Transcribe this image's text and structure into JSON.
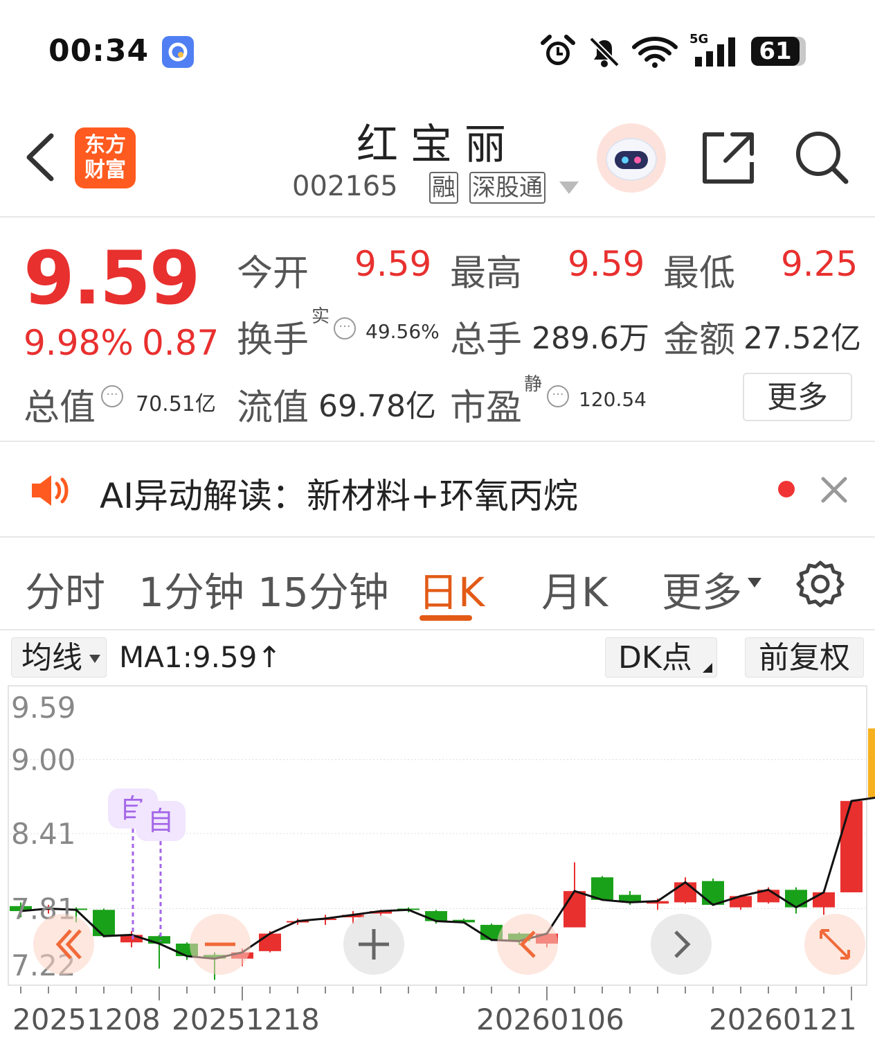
{
  "status_bar": {
    "time": "00:34",
    "network": "5G",
    "battery": "61",
    "icons": [
      "browser-app-icon",
      "alarm-icon",
      "mute-icon",
      "wifi-icon",
      "signal-icon",
      "battery-icon"
    ]
  },
  "header": {
    "stock_name": "红宝丽",
    "stock_code": "002165",
    "tags": [
      "融",
      "深股通"
    ],
    "logo_text": [
      "东方",
      "财富"
    ],
    "icons": [
      "back-icon",
      "assistant-robot-icon",
      "share-icon",
      "search-icon"
    ]
  },
  "quote": {
    "price": "9.59",
    "change_pct": "9.98%",
    "change_abs": "0.87",
    "open_label": "今开",
    "open_value": "9.59",
    "high_label": "最高",
    "high_value": "9.59",
    "low_label": "最低",
    "low_value": "9.25",
    "turnover_label": "换手",
    "turnover_sup": "实",
    "turnover_value": "49.56%",
    "volume_label": "总手",
    "volume_value": "289.6万",
    "amount_label": "金额",
    "amount_value": "27.52亿",
    "mktcap_label": "总值",
    "mktcap_value": "70.51亿",
    "float_label": "流值",
    "float_value": "69.78亿",
    "pe_label": "市盈",
    "pe_sup": "静",
    "pe_value": "120.54",
    "more_label": "更多"
  },
  "ai_bar": {
    "text": "AI异动解读：新材料+环氧丙烷"
  },
  "tabs": {
    "items": [
      "分时",
      "1分钟",
      "15分钟",
      "日K",
      "月K",
      "更多"
    ],
    "active": "日K"
  },
  "chart_toolbar": {
    "indicator": "均线",
    "ma_text": "MA1:9.59↑",
    "dk_label": "DK点",
    "adjust_label": "前复权"
  },
  "colors": {
    "up": "#e8302f",
    "down": "#1aa11a",
    "accent": "#e25a16",
    "today_candle": "#f7b11e",
    "marker": "#a466e8"
  },
  "chart_data": {
    "type": "candlestick",
    "y_ticks": [
      "9.59",
      "9.00",
      "8.41",
      "7.81",
      "7.22"
    ],
    "ylim": [
      7.22,
      9.59
    ],
    "x_tick_labels": [
      "20251208",
      "20251218",
      "20260106",
      "20260121"
    ],
    "markers": [
      "自",
      "自"
    ],
    "candles": [
      {
        "o": 7.83,
        "h": 7.86,
        "l": 7.74,
        "c": 7.79
      },
      {
        "o": 7.8,
        "h": 7.84,
        "l": 7.77,
        "c": 7.81
      },
      {
        "o": 7.81,
        "h": 7.82,
        "l": 7.7,
        "c": 7.8
      },
      {
        "o": 7.8,
        "h": 7.81,
        "l": 7.58,
        "c": 7.59
      },
      {
        "o": 7.54,
        "h": 7.63,
        "l": 7.5,
        "c": 7.6
      },
      {
        "o": 7.59,
        "h": 7.6,
        "l": 7.33,
        "c": 7.53
      },
      {
        "o": 7.53,
        "h": 7.54,
        "l": 7.4,
        "c": 7.43
      },
      {
        "o": 7.44,
        "h": 7.46,
        "l": 7.24,
        "c": 7.41
      },
      {
        "o": 7.41,
        "h": 7.49,
        "l": 7.35,
        "c": 7.46
      },
      {
        "o": 7.47,
        "h": 7.63,
        "l": 7.46,
        "c": 7.61
      },
      {
        "o": 7.7,
        "h": 7.73,
        "l": 7.68,
        "c": 7.71
      },
      {
        "o": 7.72,
        "h": 7.76,
        "l": 7.68,
        "c": 7.73
      },
      {
        "o": 7.74,
        "h": 7.79,
        "l": 7.69,
        "c": 7.76
      },
      {
        "o": 7.77,
        "h": 7.8,
        "l": 7.75,
        "c": 7.79
      },
      {
        "o": 7.81,
        "h": 7.82,
        "l": 7.78,
        "c": 7.8
      },
      {
        "o": 7.79,
        "h": 7.8,
        "l": 7.69,
        "c": 7.71
      },
      {
        "o": 7.72,
        "h": 7.73,
        "l": 7.69,
        "c": 7.7
      },
      {
        "o": 7.68,
        "h": 7.69,
        "l": 7.55,
        "c": 7.56
      },
      {
        "o": 7.61,
        "h": 7.62,
        "l": 7.52,
        "c": 7.55
      },
      {
        "o": 7.53,
        "h": 7.62,
        "l": 7.5,
        "c": 7.61
      },
      {
        "o": 7.66,
        "h": 8.18,
        "l": 7.66,
        "c": 7.95
      },
      {
        "o": 8.06,
        "h": 8.07,
        "l": 7.9,
        "c": 7.88
      },
      {
        "o": 7.92,
        "h": 7.95,
        "l": 7.84,
        "c": 7.86
      },
      {
        "o": 7.85,
        "h": 7.89,
        "l": 7.8,
        "c": 7.87
      },
      {
        "o": 7.86,
        "h": 8.06,
        "l": 7.85,
        "c": 8.02
      },
      {
        "o": 8.03,
        "h": 8.05,
        "l": 7.84,
        "c": 7.84
      },
      {
        "o": 7.82,
        "h": 7.92,
        "l": 7.8,
        "c": 7.91
      },
      {
        "o": 7.86,
        "h": 7.98,
        "l": 7.85,
        "c": 7.96
      },
      {
        "o": 7.96,
        "h": 7.98,
        "l": 7.77,
        "c": 7.82
      },
      {
        "o": 7.82,
        "h": 7.96,
        "l": 7.76,
        "c": 7.94
      },
      {
        "o": 7.94,
        "h": 8.49,
        "l": 7.94,
        "c": 8.67
      },
      {
        "o": 9.25,
        "h": 9.59,
        "l": 8.62,
        "c": 8.7
      }
    ]
  }
}
